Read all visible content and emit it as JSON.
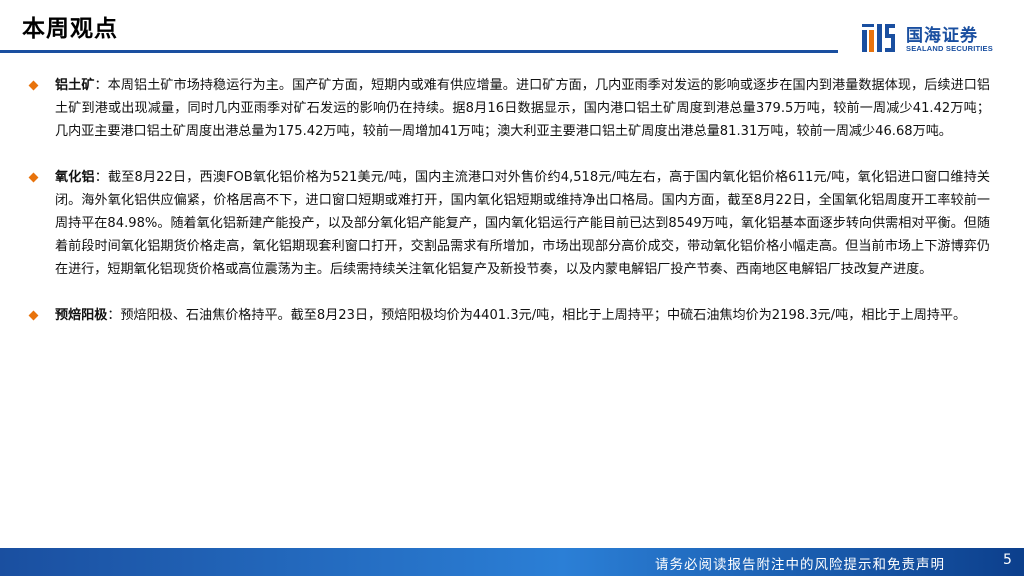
{
  "header": {
    "title": "本周观点",
    "logo_cn": "国海证券",
    "logo_en": "SEALAND SECURITIES",
    "accent_color": "#1a4fa0",
    "bullet_color": "#e8730c"
  },
  "sections": [
    {
      "lead": "铝土矿",
      "body": "：本周铝土矿市场持稳运行为主。国产矿方面，短期内或难有供应增量。进口矿方面，几内亚雨季对发运的影响或逐步在国内到港量数据体现，后续进口铝土矿到港或出现减量，同时几内亚雨季对矿石发运的影响仍在持续。据8月16日数据显示，国内港口铝土矿周度到港总量379.5万吨，较前一周减少41.42万吨；几内亚主要港口铝土矿周度出港总量为175.42万吨，较前一周增加41万吨；澳大利亚主要港口铝土矿周度出港总量81.31万吨，较前一周减少46.68万吨。"
    },
    {
      "lead": "氧化铝",
      "body": "：截至8月22日，西澳FOB氧化铝价格为521美元/吨，国内主流港口对外售价约4,518元/吨左右，高于国内氧化铝价格611元/吨，氧化铝进口窗口维持关闭。海外氧化铝供应偏紧，价格居高不下，进口窗口短期或难打开，国内氧化铝短期或维持净出口格局。国内方面，截至8月22日，全国氧化铝周度开工率较前一周持平在84.98%。随着氧化铝新建产能投产，以及部分氧化铝产能复产，国内氧化铝运行产能目前已达到8549万吨，氧化铝基本面逐步转向供需相对平衡。但随着前段时间氧化铝期货价格走高，氧化铝期现套利窗口打开，交割品需求有所增加，市场出现部分高价成交，带动氧化铝价格小幅走高。但当前市场上下游博弈仍在进行，短期氧化铝现货价格或高位震荡为主。后续需持续关注氧化铝复产及新投节奏，以及内蒙电解铝厂投产节奏、西南地区电解铝厂技改复产进度。"
    },
    {
      "lead": "预焙阳极",
      "body": "：预焙阳极、石油焦价格持平。截至8月23日，预焙阳极均价为4401.3元/吨，相比于上周持平；中硫石油焦均价为2198.3元/吨，相比于上周持平。"
    }
  ],
  "footer": {
    "disclaimer": "请务必阅读报告附注中的风险提示和免责声明",
    "page_number": "5"
  }
}
